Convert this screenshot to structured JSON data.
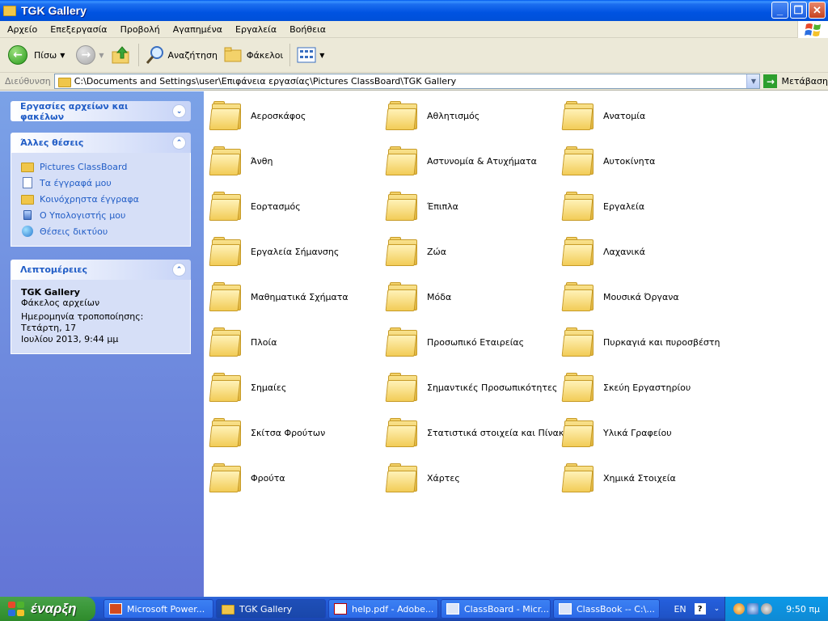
{
  "window": {
    "title": "TGK Gallery"
  },
  "caption_buttons": {
    "minimize": "_",
    "maximize": "❐",
    "close": "✕"
  },
  "menu": [
    "Αρχείο",
    "Επεξεργασία",
    "Προβολή",
    "Αγαπημένα",
    "Εργαλεία",
    "Βοήθεια"
  ],
  "toolbar": {
    "back_label": "Πίσω",
    "search_label": "Αναζήτηση",
    "folders_label": "Φάκελοι"
  },
  "address": {
    "label": "Διεύθυνση",
    "path": "C:\\Documents and Settings\\user\\Επιφάνεια εργασίας\\Pictures ClassBoard\\TGK Gallery",
    "go_label": "Μετάβαση"
  },
  "panels": {
    "tasks": {
      "title": "Εργασίες αρχείων και φακέλων"
    },
    "places": {
      "title": "Άλλες θέσεις",
      "links": [
        "Pictures ClassBoard",
        "Τα έγγραφά μου",
        "Κοινόχρηστα έγγραφα",
        "Ο Υπολογιστής μου",
        "Θέσεις δικτύου"
      ]
    },
    "details": {
      "title": "Λεπτομέρειες",
      "name": "TGK Gallery",
      "type": "Φάκελος αρχείων",
      "modified_1": "Ημερομηνία τροποποίησης: Τετάρτη, 17",
      "modified_2": "Ιουλίου 2013, 9:44 μμ"
    }
  },
  "folders": [
    "Αεροσκάφος",
    "Αθλητισμός",
    "Ανατομία",
    "Άνθη",
    "Αστυνομία & Ατυχήματα",
    "Αυτοκίνητα",
    "Εορτασμός",
    "Έπιπλα",
    "Εργαλεία",
    "Εργαλεία Σήμανσης",
    "Ζώα",
    "Λαχανικά",
    "Μαθηματικά Σχήματα",
    "Μόδα",
    "Μουσικά Όργανα",
    "Πλοία",
    "Προσωπικό Εταιρείας",
    "Πυρκαγιά και πυροσβέστη",
    "Σημαίες",
    "Σημαντικές Προσωπικότητες",
    "Σκεύη Εργαστηρίου",
    "Σκίτσα Φρούτων",
    "Στατιστικά στοιχεία και Πίνακες",
    "Υλικά Γραφείου",
    "Φρούτα",
    "Χάρτες",
    "Χημικά Στοιχεία"
  ],
  "taskbar": {
    "start_label": "έναρξη",
    "tasks": [
      "Microsoft Power...",
      "TGK Gallery",
      "help.pdf - Adobe...",
      "ClassBoard - Micr...",
      "ClassBook -- C:\\..."
    ],
    "lang": "EN",
    "help": "?",
    "clock": "9:50 πμ"
  }
}
